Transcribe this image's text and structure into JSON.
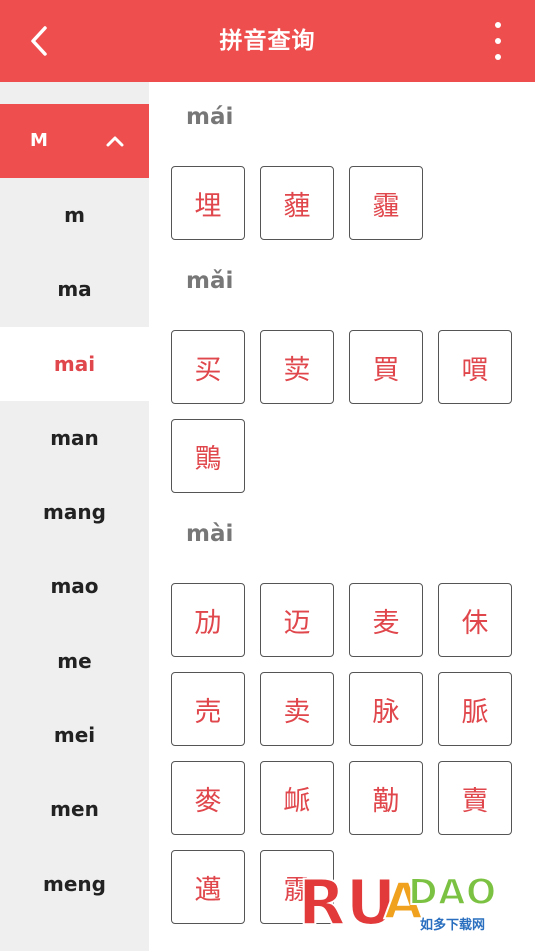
{
  "header": {
    "title": "拼音查询",
    "back_icon": "chevron-left-icon",
    "menu_icon": "more-vertical-icon"
  },
  "sidebar": {
    "group_letter": "M",
    "group_icon": "chevron-up-icon",
    "items": [
      "m",
      "ma",
      "mai",
      "man",
      "mang",
      "mao",
      "me",
      "mei",
      "men",
      "meng"
    ],
    "active": "mai"
  },
  "sections": [
    {
      "pinyin": "mái",
      "chars": [
        "埋",
        "薶",
        "霾"
      ]
    },
    {
      "pinyin": "mǎi",
      "chars": [
        "买",
        "荬",
        "買",
        "嘪",
        "鷶"
      ]
    },
    {
      "pinyin": "mài",
      "chars": [
        "劢",
        "迈",
        "麦",
        "佅",
        "売",
        "卖",
        "脉",
        "脈",
        "麥",
        "衇",
        "勱",
        "賣",
        "邁",
        "霡"
      ]
    }
  ],
  "watermark": {
    "logo_text": "RUANDAO",
    "sub_text": "如多下载网"
  },
  "colors": {
    "accent": "#ee4e4e",
    "char_red": "#e0474c",
    "sidebar_bg": "#efefef"
  }
}
